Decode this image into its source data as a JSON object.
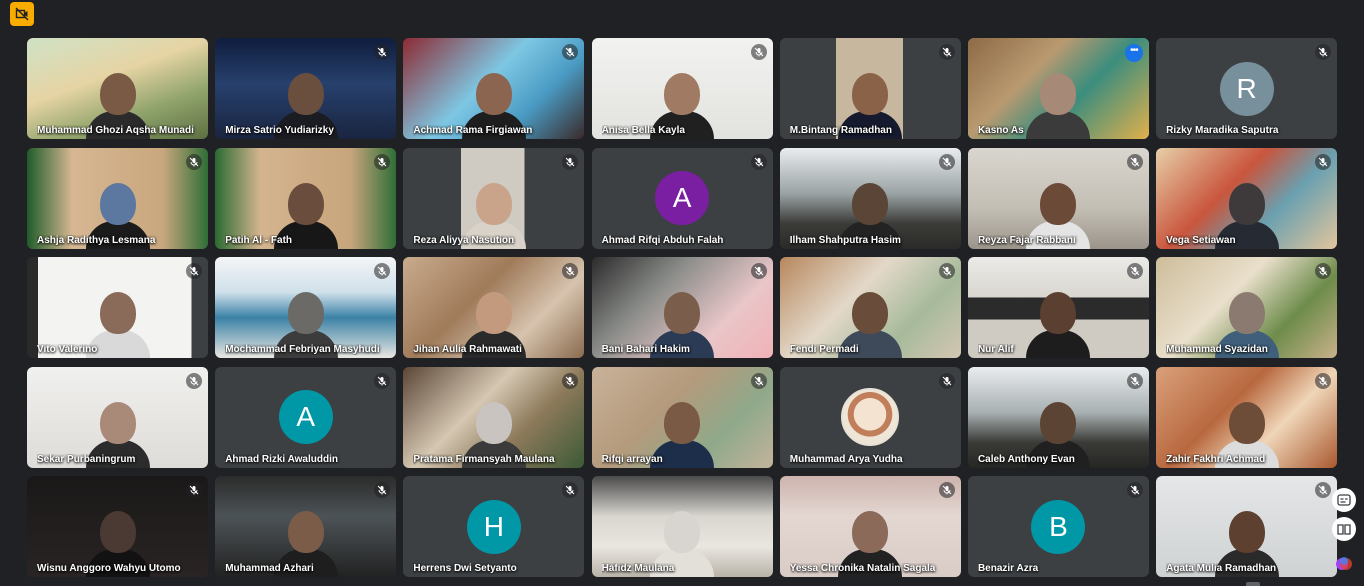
{
  "colors": {
    "background": "#202124",
    "tile": "#3c4043",
    "active_outline": "#8ab4f8",
    "badge": "#f9ab00"
  },
  "top_left_icon": "no-camera-badge-icon",
  "participants": [
    {
      "name": "Muhammad Ghozi Aqsha Munadi",
      "muted": false,
      "scene": "linear-gradient(160deg,#cfe2c6 0%,#e6d4a4 40%,#8fa36b 70%,#5d6f42 100%)",
      "skin": "#7a5a45",
      "shirt": "#2b2b2b"
    },
    {
      "name": "Mirza Satrio Yudiarizky",
      "muted": true,
      "scene": "linear-gradient(180deg,#0f1d3d 0%,#27406d 45%,#1a2540 100%)",
      "skin": "#6b4f3e",
      "shirt": "#1b1b22"
    },
    {
      "name": "Achmad Rama Firgiawan",
      "muted": true,
      "scene": "linear-gradient(135deg,#8e2a33 0%,#7ec7e3 45%,#4a9bc4 70%,#3a2a2a 100%)",
      "skin": "#8b6550",
      "shirt": "#1e1e1e"
    },
    {
      "name": "Anisa Bella Kayla",
      "muted": true,
      "scene": "linear-gradient(180deg,#f2f2f0 0%,#e2e2df 100%)",
      "skin": "#a07a62",
      "shirt": "#202020"
    },
    {
      "name": "M.Bintang Ramadhan",
      "muted": true,
      "scene": "linear-gradient(90deg,#3c4043 0 31%,#c7b79e 31% 68%,#3c4043 68% 100%)",
      "skin": "#8a6247",
      "shirt": "#151a2e"
    },
    {
      "name": "Kasno As",
      "muted": false,
      "active": true,
      "more": true,
      "scene": "linear-gradient(135deg,#8c6a46 0%,#b99a70 35%,#3b8d7d 60%,#e2b04c 100%)",
      "skin": "#a68a77",
      "shirt": "#3b3b3b"
    },
    {
      "name": "Rizky Maradika Saputra",
      "muted": true,
      "avatar": "R",
      "avatar_color": "#78909c"
    },
    {
      "name": "Ashja Radithya Lesmana",
      "muted": true,
      "scene": "linear-gradient(90deg,#1f5c2a 0%,#d6b792 25%,#c9a77e 75%,#2f6e36 100%)",
      "skin": "#5c77a0",
      "shirt": "#1b1b1b"
    },
    {
      "name": "Patih Al - Fath",
      "muted": true,
      "scene": "linear-gradient(90deg,#2b6a32 0%,#d4b48f 25%,#c7a57c 75%,#2f6e36 100%)",
      "skin": "#6a4d3c",
      "shirt": "#171717"
    },
    {
      "name": "Reza Aliyya Nasution",
      "muted": true,
      "scene": "linear-gradient(90deg,#3c4043 0 32%,#cfcac2 32% 67%,#3c4043 67% 100%)",
      "skin": "#c9a38a",
      "shirt": "#d8d2c8"
    },
    {
      "name": "Ahmad Rifqi Abduh Falah",
      "muted": true,
      "avatar": "A",
      "avatar_color": "#7b1fa2"
    },
    {
      "name": "Ilham Shahputra Hasim",
      "muted": true,
      "scene": "linear-gradient(180deg,#e9ecee 0%,#9aa3a4 45%,#3b3b38 75%,#2a2a28 100%)",
      "skin": "#5a4536",
      "shirt": "#232323"
    },
    {
      "name": "Reyza Fajar Rabbani",
      "muted": true,
      "scene": "linear-gradient(180deg,#d9d6cf 0%,#c3beb4 60%,#9b948a 100%)",
      "skin": "#6b4a37",
      "shirt": "#e4e4e4"
    },
    {
      "name": "Vega Setiawan",
      "muted": true,
      "scene": "linear-gradient(135deg,#e7cfa8 0%,#c9553d 40%,#6aa0b0 65%,#e2c59c 100%)",
      "skin": "#3e3a3c",
      "shirt": "#262a33"
    },
    {
      "name": "Vito Valerino",
      "muted": true,
      "scene": "linear-gradient(90deg,#2a2a2a 0 6%,#f3f3f1 6% 91%,#3c4043 91% 100%)",
      "skin": "#8a6a58",
      "shirt": "#d9d9d9"
    },
    {
      "name": "Mochammad Febriyan Masyhudi",
      "muted": true,
      "scene": "linear-gradient(180deg,#f4f5f6 0%,#cfe0ea 35%,#3b82a6 60%,#e9e7e2 100%)",
      "skin": "#6c6a66",
      "shirt": "#3c3c3c"
    },
    {
      "name": "Jihan Aulia Rahmawati",
      "muted": true,
      "scene": "linear-gradient(135deg,#c8ab8d 0%,#a07b5a 40%,#d6c3ae 70%,#8a6b4e 100%)",
      "skin": "#c49a7f",
      "shirt": "#2a2a2a"
    },
    {
      "name": "Bani Bahari Hakim",
      "muted": true,
      "scene": "linear-gradient(135deg,#2b2b2b 0%,#8b8d8a 35%,#e9c6c8 70%,#f0b2b8 100%)",
      "skin": "#7a5d4b",
      "shirt": "#2b3a55"
    },
    {
      "name": "Fendi Permadi",
      "muted": true,
      "scene": "linear-gradient(135deg,#b7875d 0%,#e3d8c9 40%,#a6ba9a 70%,#d3c6b3 100%)",
      "skin": "#6a4c3a",
      "shirt": "#3e4a5a"
    },
    {
      "name": "Nur Alif",
      "muted": true,
      "scene": "linear-gradient(180deg,#ebeae7 0%,#d9d6d0 40%,#2b2b2b 40% 62%,#cfcac2 62% 100%)",
      "skin": "#5b3f30",
      "shirt": "#1d1d1d"
    },
    {
      "name": "Muhammad Syazidan",
      "muted": true,
      "scene": "linear-gradient(135deg,#cdbd9a 0%,#e9dfcb 40%,#6d8c4a 70%,#c9b18a 100%)",
      "skin": "#8a7a70",
      "shirt": "#3f5f7a"
    },
    {
      "name": "Sekar Purbaningrum",
      "muted": true,
      "scene": "linear-gradient(180deg,#f0f0ee 0%,#dedcd8 100%)",
      "skin": "#a98a78",
      "shirt": "#2c2c2c"
    },
    {
      "name": "Ahmad Rizki Awaluddin",
      "muted": true,
      "avatar": "A",
      "avatar_color": "#0097a7"
    },
    {
      "name": "Pratama Firmansyah Maulana",
      "muted": true,
      "scene": "linear-gradient(135deg,#5b4636 0%,#d5c7b2 40%,#8d7a5b 65%,#3c5a36 100%)",
      "skin": "#c9c4c0",
      "shirt": "#3b3b3b"
    },
    {
      "name": "Rifqi arrayan",
      "muted": true,
      "scene": "linear-gradient(135deg,#c7b29a 0%,#b59a7c 40%,#8fa98a 70%,#c3b39c 100%)",
      "skin": "#7a5a44",
      "shirt": "#1c2e4a"
    },
    {
      "name": "Muhammad Arya Yudha",
      "muted": true,
      "avatar_img": true
    },
    {
      "name": "Caleb Anthony Evan",
      "muted": true,
      "scene": "linear-gradient(180deg,#e9ecee 0%,#a8b0b1 45%,#3a3a37 75%,#262624 100%)",
      "skin": "#5c4434",
      "shirt": "#202020"
    },
    {
      "name": "Zahir Fakhri Achmad",
      "muted": true,
      "scene": "linear-gradient(135deg,#d9a07a 0%,#b8683f 40%,#efd6b8 65%,#a9582f 100%)",
      "skin": "#6d4c38",
      "shirt": "#dcdcdc"
    },
    {
      "name": "Wisnu Anggoro Wahyu Utomo",
      "muted": true,
      "scene": "linear-gradient(180deg,#1a1818 0%,#2a2424 100%)",
      "skin": "#4a3a33",
      "shirt": "#121212"
    },
    {
      "name": "Muhammad Azhari",
      "muted": true,
      "scene": "linear-gradient(180deg,#2b2b2b 0%,#4c5356 40%,#222 100%)",
      "skin": "#7b5c49",
      "shirt": "#1e1e1e"
    },
    {
      "name": "Herrens Dwi Setyanto",
      "muted": true,
      "avatar": "H",
      "avatar_color": "#0097a7"
    },
    {
      "name": "Hafidz Maulana",
      "muted": false,
      "scene": "linear-gradient(180deg,#4a4a4a 0%,#d9d6d0 40%,#e9e6e0 70%,#b9b3a8 100%)",
      "skin": "#d8d4cf",
      "shirt": "#e3e0da"
    },
    {
      "name": "Yessa Chronika Natalin Sagala",
      "muted": true,
      "scene": "linear-gradient(180deg,#cdb3ad 0%,#e4d7d2 40%,#d9ccc6 100%)",
      "skin": "#8b6a5a",
      "shirt": "#222"
    },
    {
      "name": "Benazir Azra",
      "muted": true,
      "avatar": "B",
      "avatar_color": "#0097a7"
    },
    {
      "name": "Agata Mulia Ramadhan",
      "muted": true,
      "scene": "linear-gradient(180deg,#e4e6e7 0%,#cfd2d3 100%)",
      "skin": "#5d4030",
      "shirt": "#2a2a2a"
    }
  ],
  "side_controls": [
    {
      "name": "captions-icon"
    },
    {
      "name": "reader-icon"
    },
    {
      "name": "gemini-icon"
    }
  ]
}
